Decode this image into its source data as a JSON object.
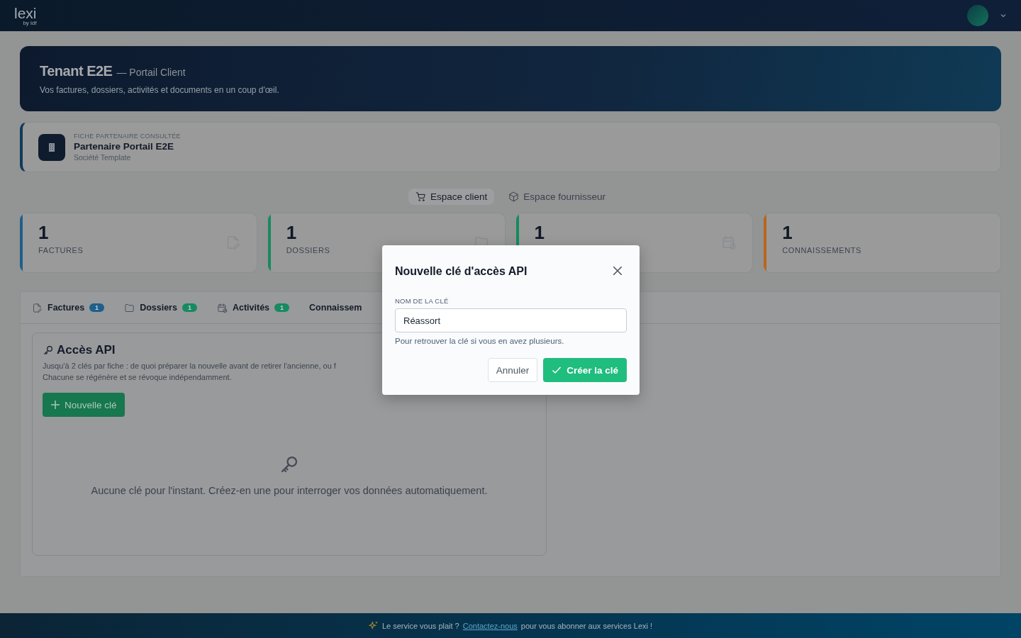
{
  "brand": {
    "logo": "lexi",
    "tagline": "by idf"
  },
  "hero": {
    "title": "Tenant E2E",
    "subtitle": "— Portail Client",
    "description": "Vos factures, dossiers, activités et documents en un coup d'œil."
  },
  "partner": {
    "eyebrow": "FICHE PARTENAIRE CONSULTÉE",
    "name": "Partenaire Portail E2E",
    "type": "Société Template"
  },
  "spaces": [
    {
      "label": "Espace client",
      "kind": "cart",
      "selected": true
    },
    {
      "label": "Espace fournisseur",
      "kind": "box",
      "selected": false
    }
  ],
  "stats": [
    {
      "value": "1",
      "label": "FACTURES",
      "color": "#1e5f8c",
      "kind": "invoice"
    },
    {
      "value": "1",
      "label": "DOSSIERS",
      "color": "#168a60",
      "kind": "folder"
    },
    {
      "value": "1",
      "color": "#168a60",
      "kind": "calendar"
    },
    {
      "value": "1",
      "label": "CONNAISSEMENTS",
      "color": "#b8661a",
      "kind": "none"
    }
  ],
  "tabs": [
    {
      "label": "Factures",
      "count": "1",
      "kind": "invoice",
      "color": "#1e5f8c"
    },
    {
      "label": "Dossiers",
      "count": "1",
      "kind": "folder",
      "color": "#168a60"
    },
    {
      "label": "Activités",
      "count": "1",
      "kind": "calendar",
      "color": "#168a60"
    },
    {
      "label": "Connaissem",
      "kind": "none"
    }
  ],
  "api": {
    "title": "Accès API",
    "description": "Jusqu'à 2 clés par fiche : de quoi préparer la nouvelle avant de retirer l'ancienne, ou f",
    "description_2": "Chacune se régénère et se révoque indépendamment.",
    "new_button": "Nouvelle clé",
    "empty": "Aucune clé pour l'instant. Créez-en une pour interroger vos données automatiquement."
  },
  "dialog": {
    "title": "Nouvelle clé d'accès API",
    "field_label": "NOM DE LA CLÉ",
    "value": "Réassort",
    "hint": "Pour retrouver la clé si vous en avez plusieurs.",
    "cancel": "Annuler",
    "confirm": "Créer la clé"
  },
  "footer": {
    "before": "Le service vous plait ?",
    "link": "Contactez-nous",
    "after": "pour vous abonner aux services Lexi !"
  }
}
